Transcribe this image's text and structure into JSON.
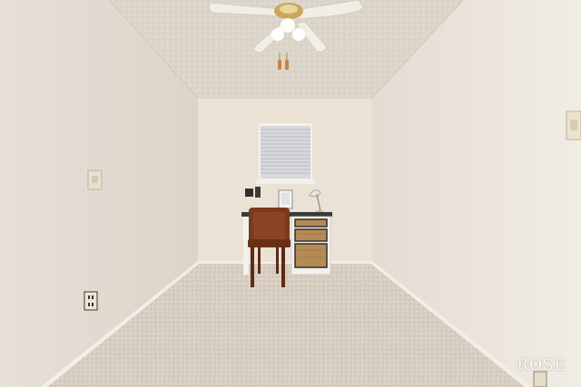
{
  "watermark": {
    "text": "ROSE"
  },
  "colors": {
    "wall_left": "#ece6de",
    "wall_right": "#efe9e2",
    "wall_back": "#ebe2d6",
    "ceiling": "#dcd6ca",
    "carpet": "#d9cfc3",
    "trim": "#f3efe8",
    "desk_white": "#f4f1ec",
    "desk_top": "#3a3a3a",
    "drawer_wicker": "#b58a55",
    "chair_wood": "#7a3a1c",
    "fan_blade": "#f2ede5",
    "fan_brass": "#c8a65a",
    "window_blind": "#d7d9db"
  }
}
